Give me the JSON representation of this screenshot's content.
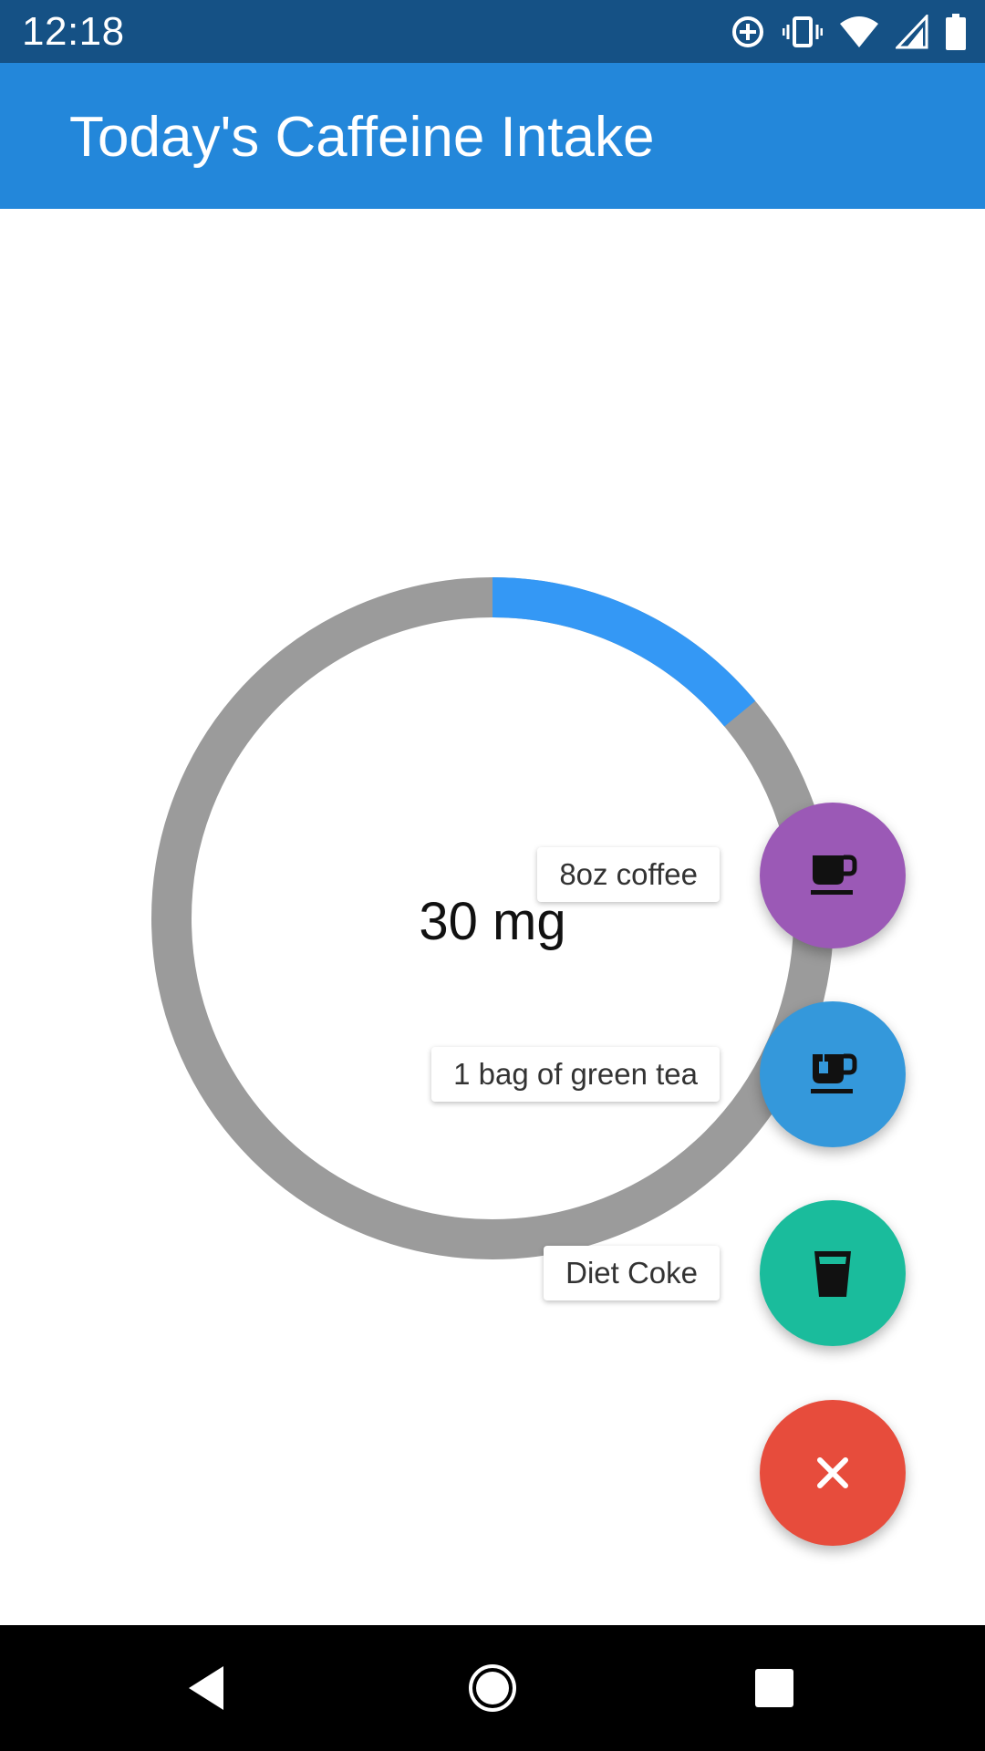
{
  "status_bar": {
    "time": "12:18",
    "icons": [
      "data-saver-icon",
      "vibrate-icon",
      "wifi-icon",
      "cell-signal-icon",
      "battery-icon"
    ]
  },
  "app_bar": {
    "title": "Today's Caffeine Intake",
    "color": "#2387DA"
  },
  "intake": {
    "value_text": "30 mg",
    "progress_fraction": 0.14,
    "track_color": "#9B9B9B",
    "progress_color": "#3498F5"
  },
  "fab_menu": {
    "items": [
      {
        "label": "8oz coffee",
        "icon": "coffee-cup-icon",
        "color": "#9B59B6"
      },
      {
        "label": "1 bag of green tea",
        "icon": "tea-cup-icon",
        "color": "#3498DB"
      },
      {
        "label": "Diet Coke",
        "icon": "glass-icon",
        "color": "#1ABC9C"
      }
    ],
    "close": {
      "icon": "close-icon",
      "color": "#E74C3C"
    }
  },
  "nav_bar": {
    "buttons": [
      "back-icon",
      "home-icon",
      "recents-icon"
    ]
  }
}
